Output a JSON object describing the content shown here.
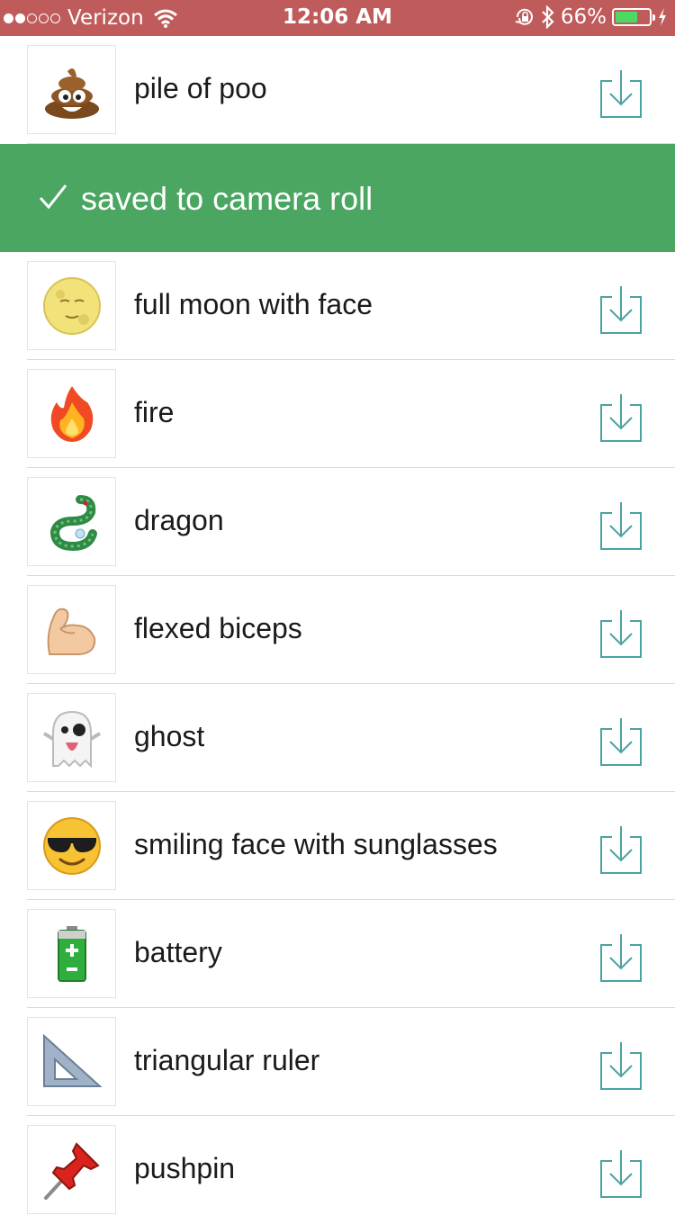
{
  "status_bar": {
    "carrier": "Verizon",
    "time": "12:06 AM",
    "battery_percent": "66%",
    "signal_bars_filled": 2,
    "signal_bars_total": 5,
    "battery_level": 0.66,
    "background_color": "#bf5b5b"
  },
  "toast": {
    "message": "saved to camera roll",
    "icon": "checkmark-icon",
    "background_color": "#4aa661"
  },
  "accent_color": "#4aa3a0",
  "items": [
    {
      "label": "pile of poo",
      "icon": "pile-of-poo-icon"
    },
    {
      "label": "full moon with face",
      "icon": "full-moon-with-face-icon"
    },
    {
      "label": "fire",
      "icon": "fire-icon"
    },
    {
      "label": "dragon",
      "icon": "dragon-icon"
    },
    {
      "label": "flexed biceps",
      "icon": "flexed-biceps-icon"
    },
    {
      "label": "ghost",
      "icon": "ghost-icon"
    },
    {
      "label": "smiling face with sunglasses",
      "icon": "smiling-face-with-sunglasses-icon"
    },
    {
      "label": "battery",
      "icon": "battery-icon"
    },
    {
      "label": "triangular ruler",
      "icon": "triangular-ruler-icon"
    },
    {
      "label": "pushpin",
      "icon": "pushpin-icon"
    }
  ]
}
